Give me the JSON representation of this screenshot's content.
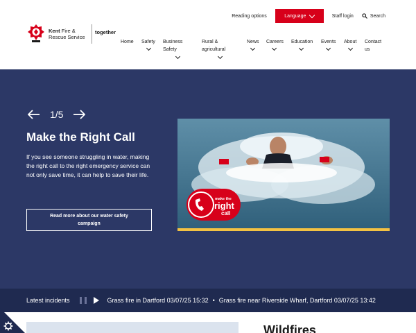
{
  "header": {
    "logo": {
      "name_bold": "Kent",
      "name_rest": " Fire &",
      "name_line2": "Rescue Service",
      "tagline": "together"
    },
    "utility": {
      "reading_options": "Reading options",
      "language": "Language",
      "staff_login": "Staff login",
      "search": "Search"
    },
    "nav": [
      {
        "label": "Home",
        "has_dropdown": false
      },
      {
        "label": "Safety",
        "has_dropdown": true
      },
      {
        "label_line1": "Business",
        "label_line2": "Safety",
        "has_dropdown": true
      },
      {
        "label_line1": "Rural &",
        "label_line2": "agricultural",
        "has_dropdown": true
      },
      {
        "label": "News",
        "has_dropdown": true
      },
      {
        "label": "Careers",
        "has_dropdown": true
      },
      {
        "label": "Education",
        "has_dropdown": true
      },
      {
        "label": "Events",
        "has_dropdown": true
      },
      {
        "label": "About",
        "has_dropdown": true
      },
      {
        "label_line1": "Contact",
        "label_line2": "us",
        "has_dropdown": false
      }
    ]
  },
  "hero": {
    "counter": "1/5",
    "title": "Make the Right Call",
    "body": "If you see someone struggling in water, making the right call to the right emergency service can not only save time, it can help to save their life.",
    "button": "Read more about our water safety campaign",
    "badge": {
      "line1": "make the",
      "line2": "right",
      "line3": "call"
    }
  },
  "ticker": {
    "label": "Latest incidents",
    "items": [
      "Grass fire in Dartford 03/07/25 15:32",
      "Grass fire near Riverside Wharf, Dartford 03/07/25 13:42"
    ],
    "separator": "•"
  },
  "below": {
    "heading": "Wildfires"
  },
  "colors": {
    "navy": "#2c3866",
    "ticker": "#1f2a50",
    "red": "#d7001a",
    "accent": "#f3c243"
  },
  "icons": [
    "crest-logo",
    "chevron-down-icon",
    "search-icon",
    "arrow-left-icon",
    "arrow-right-icon",
    "pause-icon",
    "play-icon",
    "cookie-settings-icon"
  ]
}
